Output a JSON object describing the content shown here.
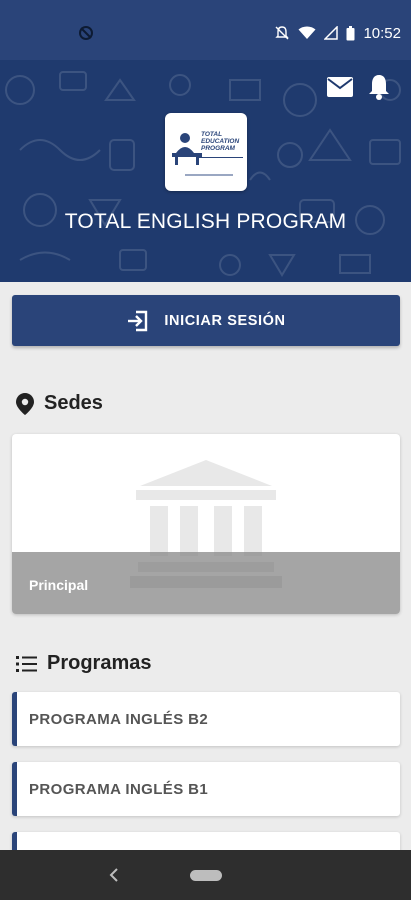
{
  "status_bar": {
    "time": "10:52"
  },
  "header": {
    "title": "TOTAL ENGLISH PROGRAM",
    "logo": {
      "line1": "TOTAL",
      "line2": "EDUCATION",
      "line3": "PROGRAM"
    },
    "mail_icon": "mail-icon",
    "notifications_icon": "bell-icon"
  },
  "login": {
    "label": "INICIAR SESIÓN",
    "icon": "login-icon"
  },
  "sedes": {
    "title": "Sedes",
    "icon": "location-pin-icon",
    "cards": [
      {
        "label": "Principal"
      }
    ]
  },
  "programas": {
    "title": "Programas",
    "icon": "list-icon",
    "items": [
      {
        "label": "PROGRAMA INGLÉS B2"
      },
      {
        "label": "PROGRAMA INGLÉS B1"
      }
    ]
  },
  "colors": {
    "primary": "#2a4479",
    "header": "#1f3a6e",
    "background": "#ececec"
  }
}
